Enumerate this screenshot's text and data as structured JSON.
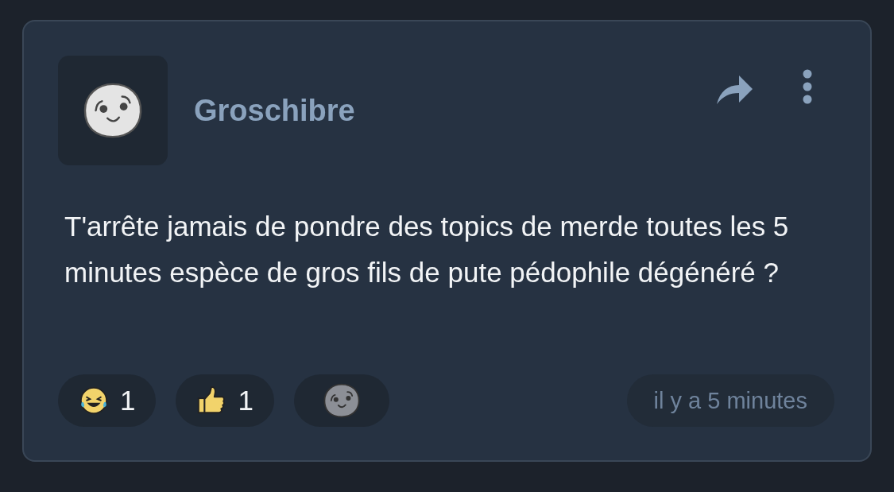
{
  "post": {
    "author": "Groschibre",
    "body": "T'arrête jamais de pondre des topics de merde toutes les 5 minutes espèce de gros fils de pute pédophile dégénéré ?",
    "reactions": [
      {
        "kind": "laugh",
        "count": "1"
      },
      {
        "kind": "thumbs",
        "count": "1"
      },
      {
        "kind": "add"
      }
    ],
    "time": "il y a 5 minutes"
  }
}
